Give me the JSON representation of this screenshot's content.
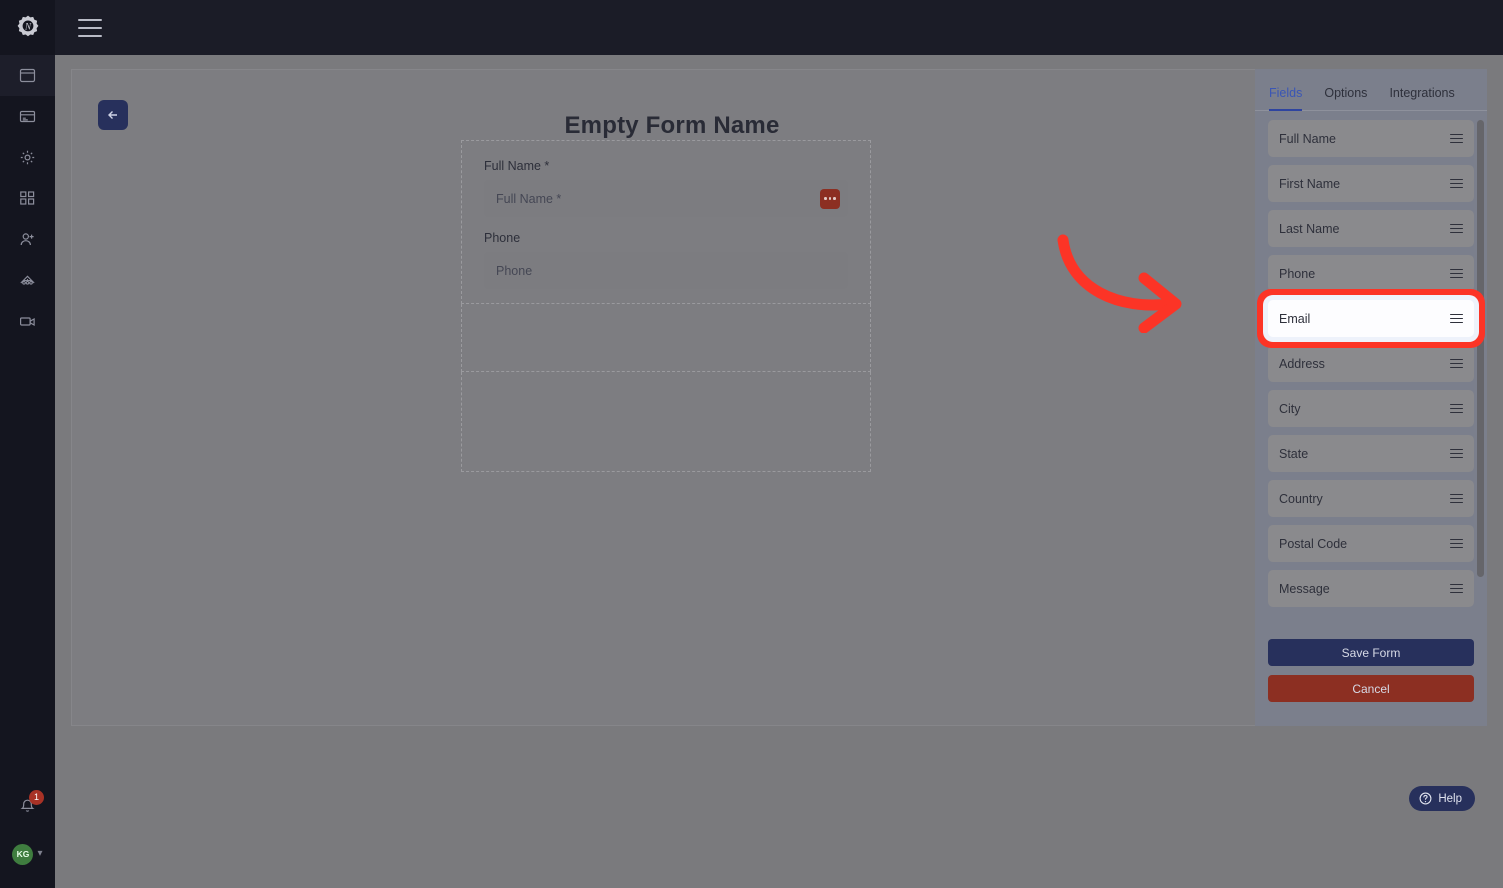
{
  "colors": {
    "rail_bg": "#14151f",
    "topbar_bg": "#1b1c27",
    "page_bg": "#7a7a7d",
    "panel_bg": "#7b7f8c",
    "accent_blue": "#27305c",
    "accent_red": "#8c2f22",
    "tab_active": "#3a56b5",
    "highlight_red": "#fc3426",
    "avatar_green": "#3f7d3f"
  },
  "topbar": {
    "logo_icon": "gear-n-logo",
    "menu_icon": "hamburger-menu-icon"
  },
  "sidebar": {
    "items": [
      {
        "icon": "window-icon",
        "active": true
      },
      {
        "icon": "card-list-icon",
        "active": false
      },
      {
        "icon": "gear-icon",
        "active": false
      },
      {
        "icon": "widgets-icon",
        "active": false
      },
      {
        "icon": "add-user-icon",
        "active": false
      },
      {
        "icon": "network-hierarchy-icon",
        "active": false
      },
      {
        "icon": "video-camera-icon",
        "active": false
      }
    ],
    "notification": {
      "icon": "bell-icon",
      "count": "1"
    },
    "user": {
      "initials": "KG",
      "chevron_icon": "chevron-down-icon"
    }
  },
  "canvas": {
    "back_button_icon": "arrow-left-icon",
    "form_title": "Empty Form Name",
    "fields": [
      {
        "label": "Full Name *",
        "placeholder": "Full Name *",
        "has_menu": true,
        "menu_icon": "ellipsis-icon"
      },
      {
        "label": "Phone",
        "placeholder": "Phone",
        "has_menu": false
      }
    ],
    "empty_dropzones": 2
  },
  "panel": {
    "tabs": [
      {
        "label": "Fields",
        "active": true
      },
      {
        "label": "Options",
        "active": false
      },
      {
        "label": "Integrations",
        "active": false
      }
    ],
    "field_items": [
      {
        "label": "Full Name",
        "handle_icon": "drag-handle-icon",
        "highlighted": false
      },
      {
        "label": "First Name",
        "handle_icon": "drag-handle-icon",
        "highlighted": false
      },
      {
        "label": "Last Name",
        "handle_icon": "drag-handle-icon",
        "highlighted": false
      },
      {
        "label": "Phone",
        "handle_icon": "drag-handle-icon",
        "highlighted": false
      },
      {
        "label": "Email",
        "handle_icon": "drag-handle-icon",
        "highlighted": true
      },
      {
        "label": "Address",
        "handle_icon": "drag-handle-icon",
        "highlighted": false
      },
      {
        "label": "City",
        "handle_icon": "drag-handle-icon",
        "highlighted": false
      },
      {
        "label": "State",
        "handle_icon": "drag-handle-icon",
        "highlighted": false
      },
      {
        "label": "Country",
        "handle_icon": "drag-handle-icon",
        "highlighted": false
      },
      {
        "label": "Postal Code",
        "handle_icon": "drag-handle-icon",
        "highlighted": false
      },
      {
        "label": "Message",
        "handle_icon": "drag-handle-icon",
        "highlighted": false
      }
    ],
    "save_label": "Save Form",
    "cancel_label": "Cancel"
  },
  "annotation": {
    "arrow_icon": "curved-arrow-right-icon",
    "target": "Email"
  },
  "help": {
    "label": "Help",
    "icon": "question-circle-icon"
  }
}
